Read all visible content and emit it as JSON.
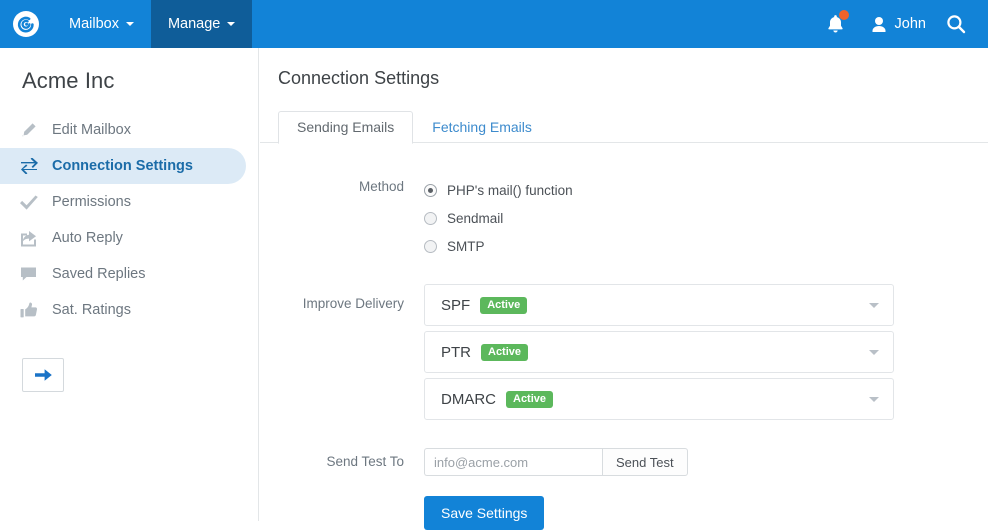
{
  "topnav": {
    "logo_icon": "spiral-logo-icon",
    "items": [
      {
        "label": "Mailbox",
        "active": false
      },
      {
        "label": "Manage",
        "active": true
      }
    ],
    "notifications_icon": "bell-icon",
    "has_notification_badge": true,
    "user": {
      "name": "John",
      "icon": "user-icon"
    },
    "search_icon": "search-icon",
    "background_color": "#1283d7",
    "active_item_color": "#0f5d99"
  },
  "sidebar": {
    "brand": "Acme Inc",
    "items": [
      {
        "label": "Edit Mailbox",
        "icon": "pencil-icon",
        "selected": false
      },
      {
        "label": "Connection Settings",
        "icon": "exchange-arrows-icon",
        "selected": true
      },
      {
        "label": "Permissions",
        "icon": "check-icon",
        "selected": false
      },
      {
        "label": "Auto Reply",
        "icon": "share-arrow-icon",
        "selected": false
      },
      {
        "label": "Saved Replies",
        "icon": "comment-icon",
        "selected": false
      },
      {
        "label": "Sat. Ratings",
        "icon": "thumbs-up-icon",
        "selected": false
      }
    ],
    "next_button_icon": "arrow-right-icon",
    "selected_bg_color": "#dceaf6",
    "selected_text_color": "#1b6ca8"
  },
  "main": {
    "page_title": "Connection Settings",
    "tabs": [
      {
        "label": "Sending Emails",
        "active": true
      },
      {
        "label": "Fetching Emails",
        "active": false
      }
    ],
    "method": {
      "label": "Method",
      "options": [
        {
          "label": "PHP's mail() function",
          "checked": true
        },
        {
          "label": "Sendmail",
          "checked": false
        },
        {
          "label": "SMTP",
          "checked": false
        }
      ]
    },
    "improve_delivery": {
      "label": "Improve Delivery",
      "panels": [
        {
          "name": "SPF",
          "status": "Active",
          "caret_icon": "chevron-down-icon"
        },
        {
          "name": "PTR",
          "status": "Active",
          "caret_icon": "chevron-down-icon"
        },
        {
          "name": "DMARC",
          "status": "Active",
          "caret_icon": "chevron-down-icon"
        }
      ],
      "status_color": "#5cb85c"
    },
    "send_test": {
      "label": "Send Test To",
      "placeholder": "info@acme.com",
      "value": "",
      "button_label": "Send Test"
    },
    "save_label": "Save Settings",
    "save_color": "#1283d7"
  }
}
